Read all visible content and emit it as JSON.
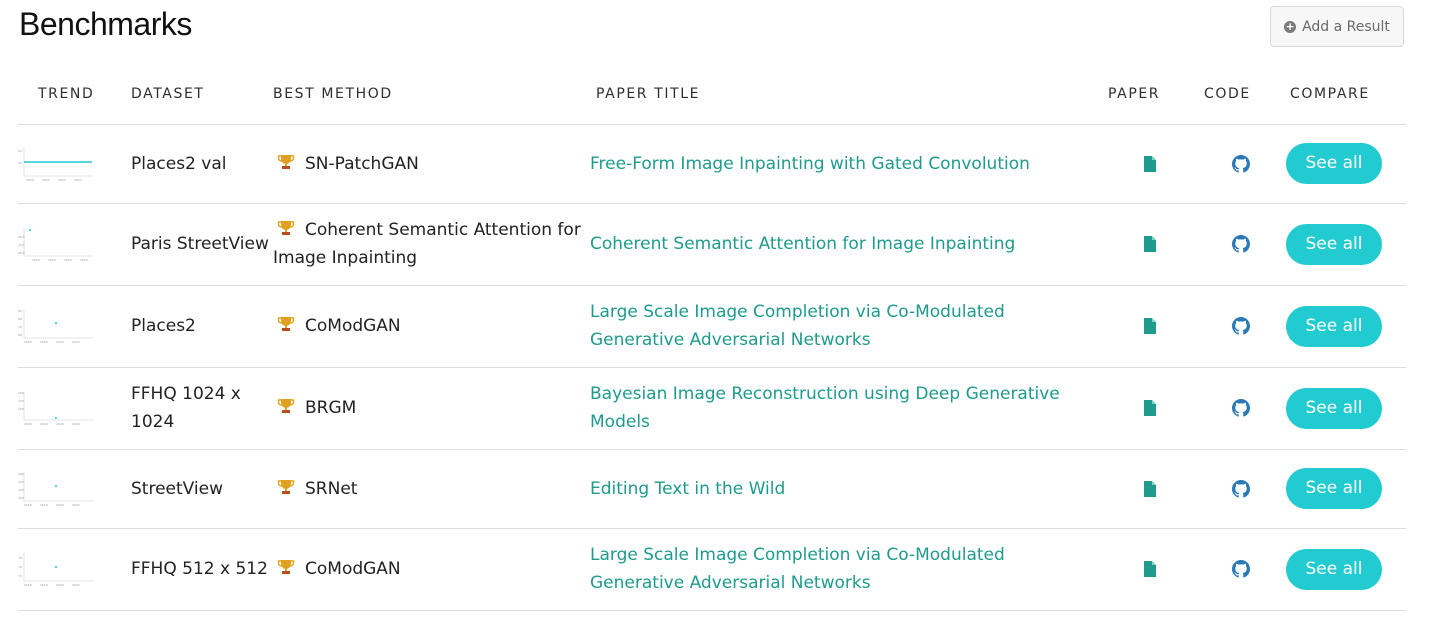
{
  "header": {
    "title": "Benchmarks",
    "add_result_label": "Add a Result"
  },
  "columns": {
    "trend": "TREND",
    "dataset": "DATASET",
    "best_method": "BEST METHOD",
    "paper_title": "PAPER TITLE",
    "paper": "PAPER",
    "code": "CODE",
    "compare": "COMPARE"
  },
  "rows": [
    {
      "dataset": "Places2 val",
      "method": "SN-PatchGAN",
      "paper_title": "Free-Form Image Inpainting with Gated Convolution",
      "compare_label": "See all"
    },
    {
      "dataset": "Paris StreetView",
      "method": "Coherent Semantic Attention for Image Inpainting",
      "paper_title": "Coherent Semantic Attention for Image Inpainting",
      "compare_label": "See all"
    },
    {
      "dataset": "Places2",
      "method": "CoModGAN",
      "paper_title": "Large Scale Image Completion via Co-Modulated Generative Adversarial Networks",
      "compare_label": "See all"
    },
    {
      "dataset": "FFHQ 1024 x 1024",
      "method": "BRGM",
      "paper_title": "Bayesian Image Reconstruction using Deep Generative Models",
      "compare_label": "See all"
    },
    {
      "dataset": "StreetView",
      "method": "SRNet",
      "paper_title": "Editing Text in the Wild",
      "compare_label": "See all"
    },
    {
      "dataset": "FFHQ 512 x 512",
      "method": "CoModGAN",
      "paper_title": "Large Scale Image Completion via Co-Modulated Generative Adversarial Networks",
      "compare_label": "See all"
    }
  ],
  "colors": {
    "accent": "#21cbcf",
    "link": "#1e9b8d",
    "code_icon": "#2a7ab8",
    "trophy": "#e0a020"
  },
  "icons": {
    "add": "plus-circle-icon",
    "method": "trophy-icon",
    "paper": "file-icon",
    "code": "github-icon"
  }
}
